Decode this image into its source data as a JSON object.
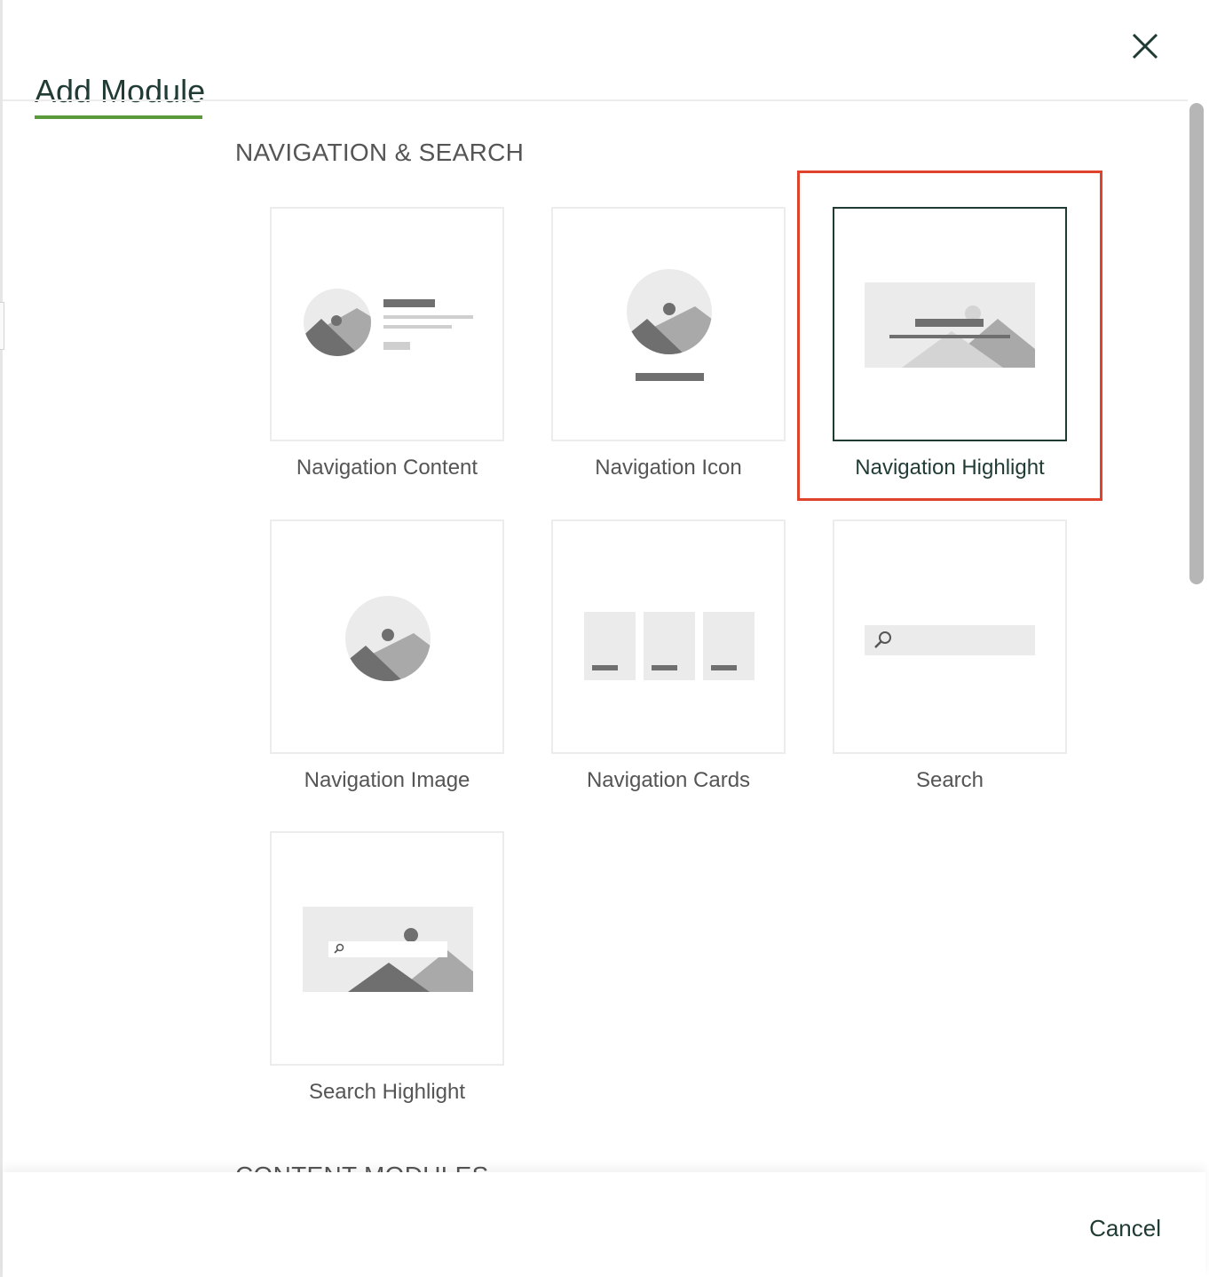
{
  "dialog": {
    "title": "Add Module",
    "close_icon": "close-icon",
    "cancel_label": "Cancel"
  },
  "sections": [
    {
      "title": "NAVIGATION & SEARCH",
      "modules": [
        {
          "label": "Navigation Content",
          "icon": "navigation-content-icon"
        },
        {
          "label": "Navigation Icon",
          "icon": "navigation-icon-icon"
        },
        {
          "label": "Navigation Highlight",
          "icon": "navigation-highlight-icon",
          "selected": true
        },
        {
          "label": "Navigation Image",
          "icon": "navigation-image-icon"
        },
        {
          "label": "Navigation Cards",
          "icon": "navigation-cards-icon"
        },
        {
          "label": "Search",
          "icon": "search-module-icon"
        },
        {
          "label": "Search Highlight",
          "icon": "search-highlight-icon"
        }
      ]
    },
    {
      "title": "CONTENT MODULES"
    }
  ],
  "colors": {
    "accent_underline": "#5a9a3a",
    "title_text": "#1f3b33",
    "selection_frame": "#e0432b"
  }
}
